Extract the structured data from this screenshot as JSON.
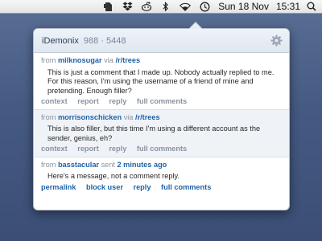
{
  "menubar": {
    "icons": [
      "evernote-icon",
      "dropbox-icon",
      "reddit-alien-icon",
      "bluetooth-icon",
      "wifi-icon",
      "time-machine-icon"
    ],
    "date": "Sun 18 Nov",
    "time": "15:31"
  },
  "popover": {
    "username": "iDemonix",
    "karma": "988 · 5448",
    "messages": [
      {
        "from_label": "from",
        "author": "milknosugar",
        "via_label": "via",
        "subreddit": "/r/trees",
        "body": "This is just a comment that I made up. Nobody actually replied to me. For this reason, I'm using the username of a friend of mine and pretending. Enough filler?",
        "actions": [
          "context",
          "report",
          "reply",
          "full comments"
        ]
      },
      {
        "from_label": "from",
        "author": "morrisonschicken",
        "via_label": "via",
        "subreddit": "/r/trees",
        "body": "This is also filler, but this time I'm using a different account as the sender, genius, eh?",
        "actions": [
          "context",
          "report",
          "reply",
          "full comments"
        ]
      },
      {
        "from_label": "from",
        "author": "basstacular",
        "sent_label": "sent",
        "when": "2 minutes ago",
        "body": "Here's a message, not a comment reply.",
        "actions": [
          "permalink",
          "block user",
          "reply",
          "full comments"
        ]
      }
    ]
  }
}
